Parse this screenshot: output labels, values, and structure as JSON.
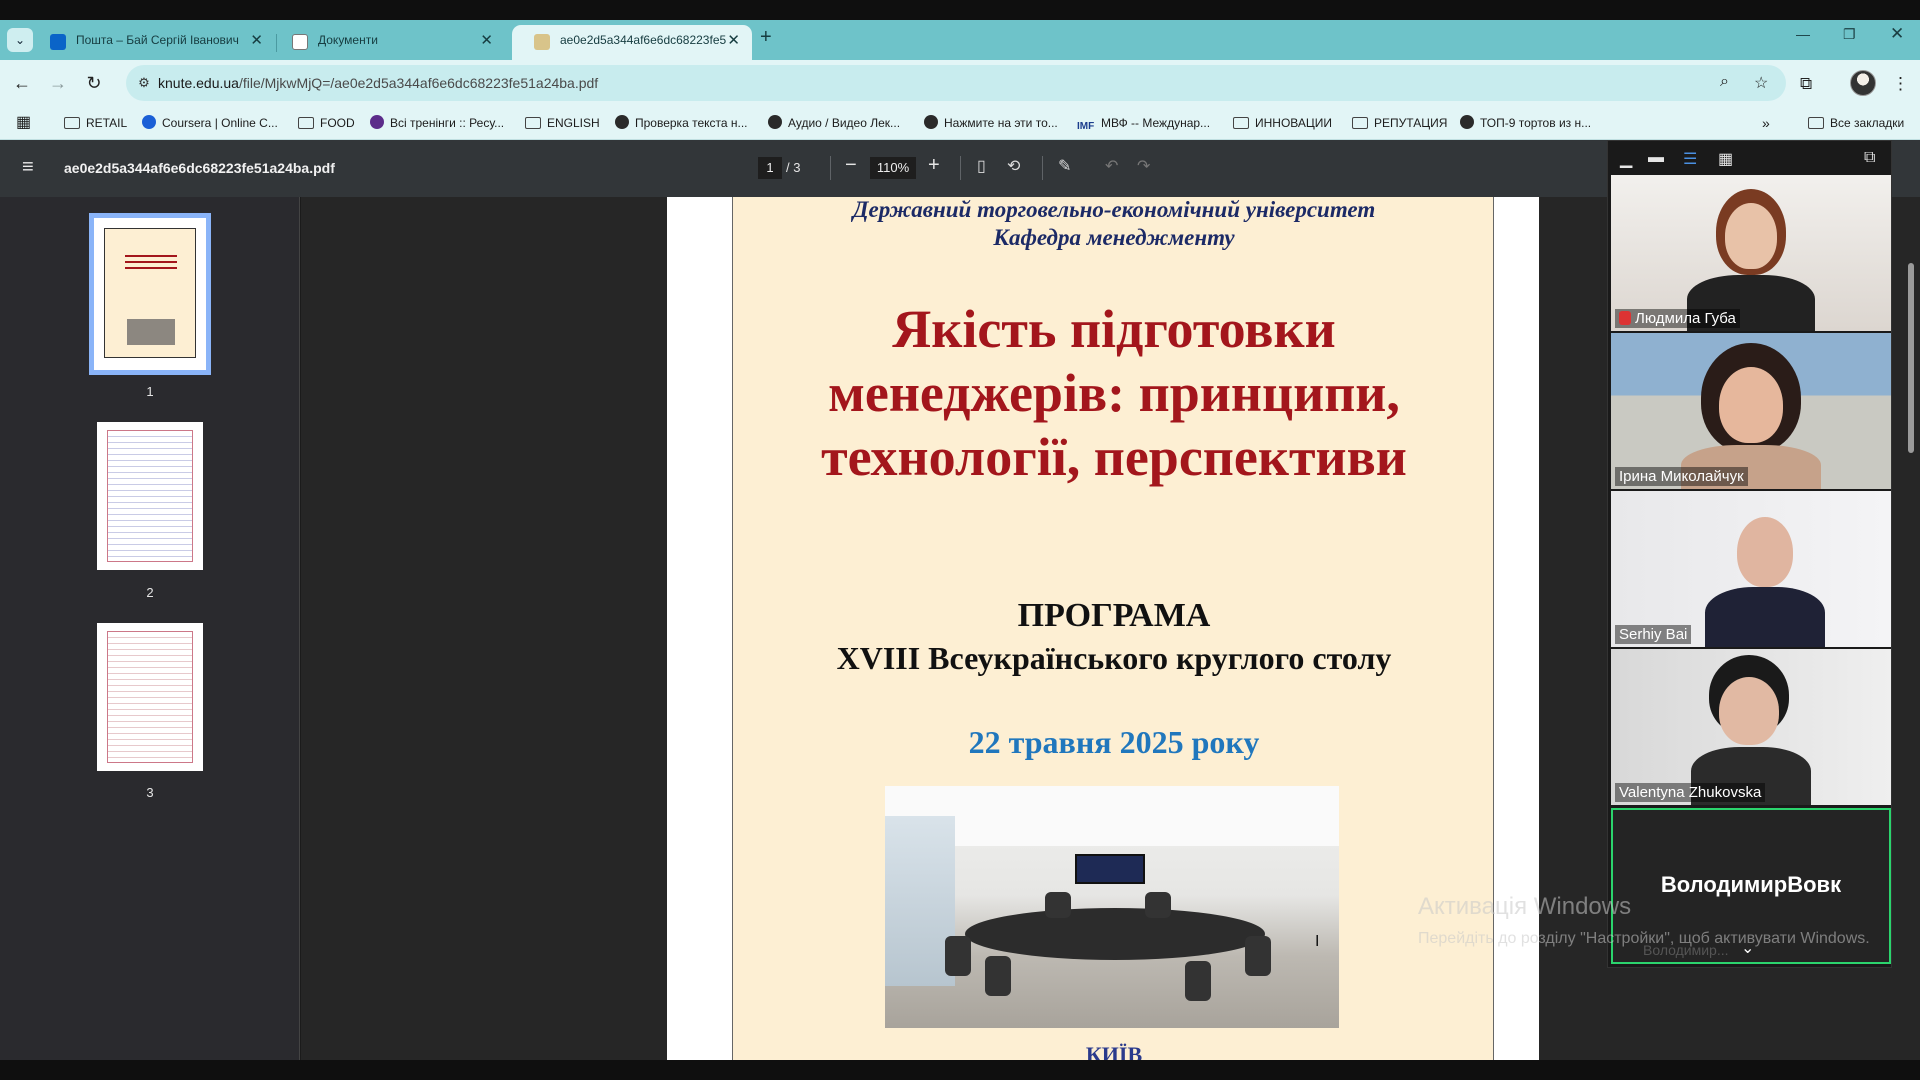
{
  "tabs": [
    {
      "title": "Пошта – Бай Сергій Іванович",
      "active": false
    },
    {
      "title": "Документи",
      "active": false
    },
    {
      "title": "ae0e2d5a344af6e6dc68223fe5",
      "active": true
    }
  ],
  "toolbar": {
    "url_domain": "knute.edu.ua",
    "url_path": "/file/MjkwMjQ=/ae0e2d5a344af6e6dc68223fe51a24ba.pdf"
  },
  "bookmarks": [
    {
      "label": "RETAIL",
      "icon": "folder-icon"
    },
    {
      "label": "Coursera | Online C...",
      "icon": "coursera-icon"
    },
    {
      "label": "FOOD",
      "icon": "folder-icon"
    },
    {
      "label": "Всі тренінги :: Ресу...",
      "icon": "training-icon"
    },
    {
      "label": "ENGLISH",
      "icon": "folder-icon"
    },
    {
      "label": "Проверка текста н...",
      "icon": "globe-icon"
    },
    {
      "label": "Аудио / Видео Лек...",
      "icon": "audio-icon"
    },
    {
      "label": "Нажмите на эти то...",
      "icon": "globe-icon"
    },
    {
      "label": "МВФ -- Междунар...",
      "icon": "imf-icon"
    },
    {
      "label": "ИННОВАЦИИ",
      "icon": "folder-icon"
    },
    {
      "label": "РЕПУТАЦИЯ",
      "icon": "folder-icon"
    },
    {
      "label": "ТОП-9 тортов из н...",
      "icon": "globe-icon"
    }
  ],
  "bookmarks_all": "Все закладки",
  "pdf": {
    "filename": "ae0e2d5a344af6e6dc68223fe51a24ba.pdf",
    "current_page": "1",
    "total_pages": "/ 3",
    "zoom": "110%",
    "thumb_labels": [
      "1",
      "2",
      "3"
    ]
  },
  "document": {
    "university": "Державний торговельно-економічний університет",
    "department": "Кафедра менеджменту",
    "title_line1": "Якість підготовки",
    "title_line2": "менеджерів: принципи,",
    "title_line3": "технології, перспективи",
    "program": "ПРОГРАМА",
    "event": "XVIII Всеукраїнського круглого столу",
    "date": "22 травня 2025 року",
    "city": "КИЇВ"
  },
  "video": {
    "participants": [
      {
        "name": "Людмила Губа",
        "muted": true
      },
      {
        "name": "Ірина Миколайчук",
        "muted": false
      },
      {
        "name": "Serhiy Bai",
        "muted": false
      },
      {
        "name": "Valentyna Zhukovska",
        "muted": false
      }
    ],
    "speaker_name": "ВолодимирВовк",
    "speaker_small": "Володимир..."
  },
  "windows_activation": {
    "title": "Активація Windows",
    "line": "Перейдіть до розділу \"Настройки\", щоб активувати Windows."
  },
  "colors": {
    "tab_strip": "#6ec3c9",
    "toolbar": "#e2f5f6",
    "doc_title": "#a3161c",
    "doc_date": "#2077bd",
    "active_speaker": "#2bd46d"
  }
}
